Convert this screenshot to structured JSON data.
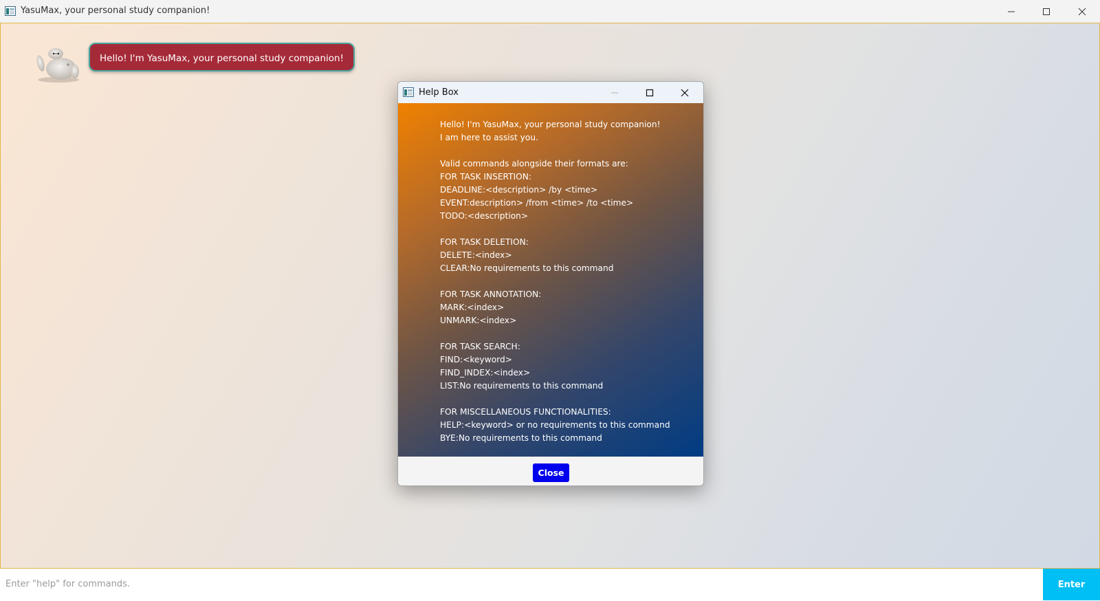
{
  "window": {
    "title": "YasuMax, your personal study companion!"
  },
  "chat": {
    "avatar_icon": "robot-avatar-icon",
    "greeting": "Hello! I'm YasuMax, your personal study companion!"
  },
  "help_dialog": {
    "title": "Help Box",
    "lines": [
      "Hello! I'm YasuMax, your personal study companion!",
      "I am here to assist you.",
      "",
      "Valid commands alongside their formats are:",
      "FOR TASK INSERTION:",
      "DEADLINE:<description> /by <time>",
      "EVENT:description> /from <time> /to <time>",
      "TODO:<description>",
      "",
      "FOR TASK DELETION:",
      "DELETE:<index>",
      "CLEAR:No requirements to this command",
      "",
      "FOR TASK ANNOTATION:",
      "MARK:<index>",
      "UNMARK:<index>",
      "",
      "FOR TASK SEARCH:",
      "FIND:<keyword>",
      "FIND_INDEX:<index>",
      "LIST:No requirements to this command",
      "",
      "FOR MISCELLANEOUS FUNCTIONALITIES:",
      "HELP:<keyword> or no requirements to this command",
      "BYE:No requirements to this command"
    ],
    "close_label": "Close"
  },
  "input": {
    "placeholder": "Enter \"help\" for commands.",
    "value": "",
    "enter_label": "Enter"
  },
  "colors": {
    "speech_bubble": "#a52a38",
    "enter_button": "#00bff5",
    "close_button": "#0000ee",
    "border_accent": "#e0b54a"
  }
}
